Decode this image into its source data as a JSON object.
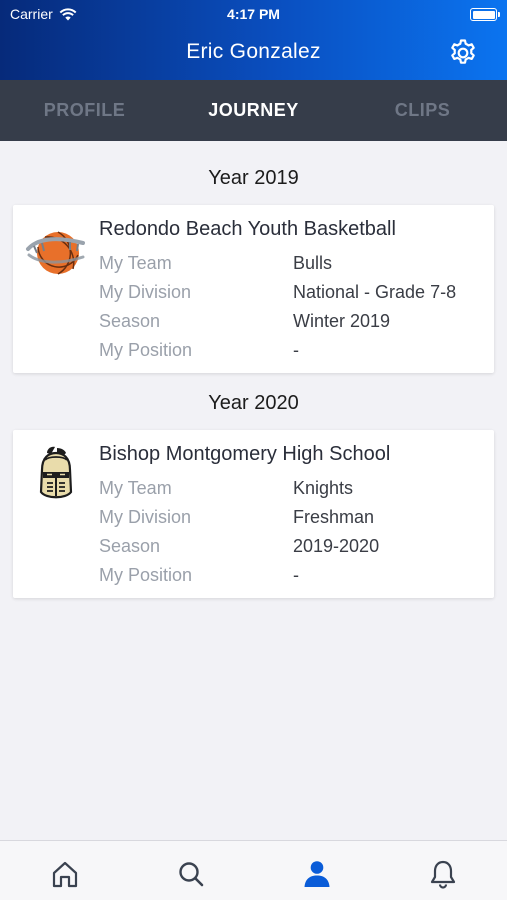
{
  "status_bar": {
    "carrier": "Carrier",
    "time": "4:17 PM"
  },
  "header": {
    "title": "Eric Gonzalez",
    "settings_icon": "gear-icon"
  },
  "tabs": [
    {
      "label": "PROFILE",
      "active": false
    },
    {
      "label": "JOURNEY",
      "active": true
    },
    {
      "label": "CLIPS",
      "active": false
    }
  ],
  "journey": [
    {
      "year": "Year 2019",
      "organization": "Redondo Beach Youth Basketball",
      "logo_icon": "basketball-icon",
      "rows": [
        {
          "label": "My Team",
          "value": "Bulls"
        },
        {
          "label": "My Division",
          "value": "National - Grade 7-8"
        },
        {
          "label": "Season",
          "value": "Winter 2019"
        },
        {
          "label": "My Position",
          "value": "-"
        }
      ]
    },
    {
      "year": "Year 2020",
      "organization": "Bishop Montgomery High School",
      "logo_icon": "knight-helmet-icon",
      "rows": [
        {
          "label": "My Team",
          "value": "Knights"
        },
        {
          "label": "My Division",
          "value": "Freshman"
        },
        {
          "label": "Season",
          "value": "2019-2020"
        },
        {
          "label": "My Position",
          "value": "-"
        }
      ]
    }
  ],
  "bottom_nav": [
    {
      "icon": "home-icon",
      "active": false
    },
    {
      "icon": "search-icon",
      "active": false
    },
    {
      "icon": "person-icon",
      "active": true
    },
    {
      "icon": "bell-icon",
      "active": false
    }
  ],
  "colors": {
    "accent": "#0a5cd8",
    "tab_bar_bg": "#363d4a",
    "inactive_icon": "#3a4250"
  }
}
